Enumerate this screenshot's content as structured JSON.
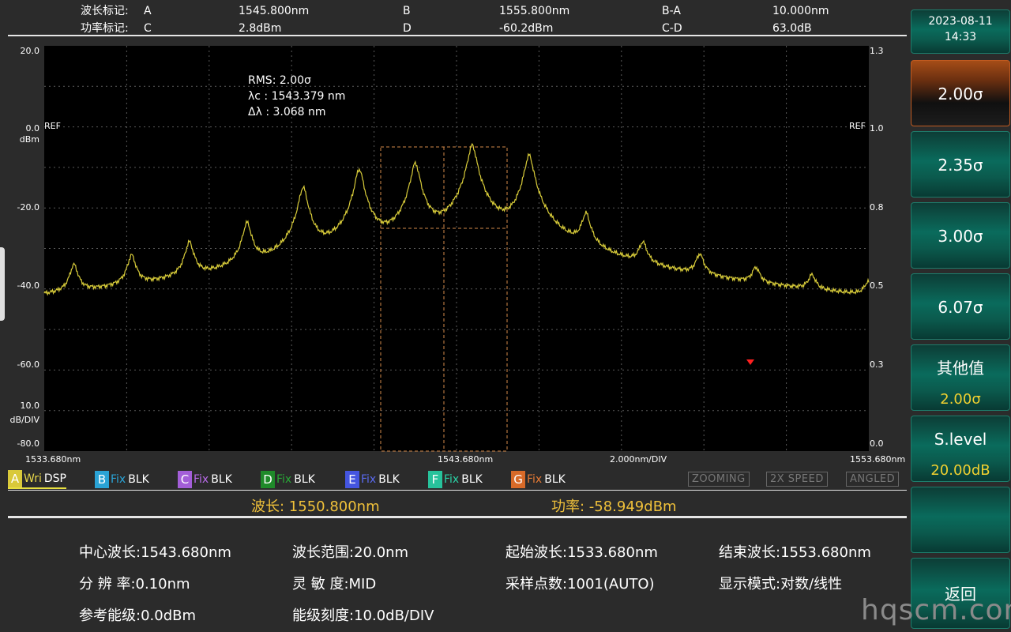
{
  "markers": {
    "wave_label": "波长标记:",
    "power_label": "功率标记:",
    "a_name": "A",
    "a_value": "1545.800nm",
    "b_name": "B",
    "b_value": "1555.800nm",
    "ba_name": "B-A",
    "ba_value": "10.000nm",
    "c_name": "C",
    "c_value": "2.8dBm",
    "d_name": "D",
    "d_value": "-60.2dBm",
    "cd_name": "C-D",
    "cd_value": "63.0dB"
  },
  "chart_data": {
    "type": "line",
    "y_left_ticks": [
      "20.0",
      "0.0",
      "-20.0",
      "-40.0",
      "-60.0",
      "-80.0"
    ],
    "y_left_unit": "dBm",
    "y_left_scale_value": "10.0",
    "y_left_scale_unit": "dB/DIV",
    "y_right_ticks": [
      "1.3",
      "1.0",
      "0.8",
      "0.5",
      "0.3",
      "0.0"
    ],
    "ref_label": "REF",
    "x_start": "1533.680nm",
    "x_center": "1543.680nm",
    "x_div": "2.000nm/DIV",
    "x_end": "1553.680nm",
    "xlim": [
      1533.68,
      1553.68
    ],
    "ylim": [
      -80,
      20
    ],
    "grid": true,
    "trace_color": "#d8cc3a",
    "peaks": [
      {
        "x": 1534.4,
        "y": -35
      },
      {
        "x": 1535.8,
        "y": -32.5
      },
      {
        "x": 1537.2,
        "y": -29
      },
      {
        "x": 1538.6,
        "y": -24
      },
      {
        "x": 1539.96,
        "y": -15
      },
      {
        "x": 1541.32,
        "y": -10.5
      },
      {
        "x": 1542.68,
        "y": -9
      },
      {
        "x": 1544.06,
        "y": -4.5
      },
      {
        "x": 1545.44,
        "y": -7
      },
      {
        "x": 1546.82,
        "y": -22
      },
      {
        "x": 1548.2,
        "y": -30
      },
      {
        "x": 1549.58,
        "y": -33
      },
      {
        "x": 1550.94,
        "y": -37
      },
      {
        "x": 1552.3,
        "y": -39
      },
      {
        "x": 1553.66,
        "y": -41
      }
    ],
    "floor_dbm": -63
  },
  "rms": {
    "line1": "RMS:  2.00σ",
    "line2": "λc    : 1543.379 nm",
    "line3": "Δλ    : 3.068 nm"
  },
  "traces": [
    {
      "letter": "A",
      "mode": "Wri",
      "state": "DSP",
      "letter_bg": "#d9c93a",
      "mode_color": "#e8d84a"
    },
    {
      "letter": "B",
      "mode": "Fix",
      "state": "BLK",
      "letter_bg": "#2aa3d6",
      "mode_color": "#2aa3d6"
    },
    {
      "letter": "C",
      "mode": "Fix",
      "state": "BLK",
      "letter_bg": "#a35ed8",
      "mode_color": "#b86ae8"
    },
    {
      "letter": "D",
      "mode": "Fix",
      "state": "BLK",
      "letter_bg": "#1f8a2a",
      "mode_color": "#29a837"
    },
    {
      "letter": "E",
      "mode": "Fix",
      "state": "BLK",
      "letter_bg": "#4455e0",
      "mode_color": "#5a6af0"
    },
    {
      "letter": "F",
      "mode": "Fix",
      "state": "BLK",
      "letter_bg": "#27c29b",
      "mode_color": "#2ad2a6"
    },
    {
      "letter": "G",
      "mode": "Fix",
      "state": "BLK",
      "letter_bg": "#d86a28",
      "mode_color": "#e57a34"
    }
  ],
  "flags": [
    "ZOOMING",
    "2X SPEED",
    "ANGLED"
  ],
  "readout": {
    "wavelength": "波长: 1550.800nm",
    "power": "功率: -58.949dBm"
  },
  "params": {
    "center": "中心波长:1543.680nm",
    "span": "波长范围:20.0nm",
    "start": "起始波长:1533.680nm",
    "stop": "结束波长:1553.680nm",
    "resolution": "分  辨  率:0.10nm",
    "sensitivity": "灵  敏  度:MID",
    "points": "采样点数:1001(AUTO)",
    "display_mode": "显示模式:对数/线性",
    "ref_level": "参考能级:0.0dBm",
    "scale": "能级刻度:10.0dB/DIV"
  },
  "softkeys": {
    "date": "2023-08-11",
    "time": "14:33",
    "k1": "2.00σ",
    "k2": "2.35σ",
    "k3": "3.00σ",
    "k4": "6.07σ",
    "k5_label": "其他值",
    "k5_value": "2.00σ",
    "k6_label": "S.level",
    "k6_value": "20.00dB",
    "k8": "返回"
  },
  "watermark": "hqscm.com"
}
